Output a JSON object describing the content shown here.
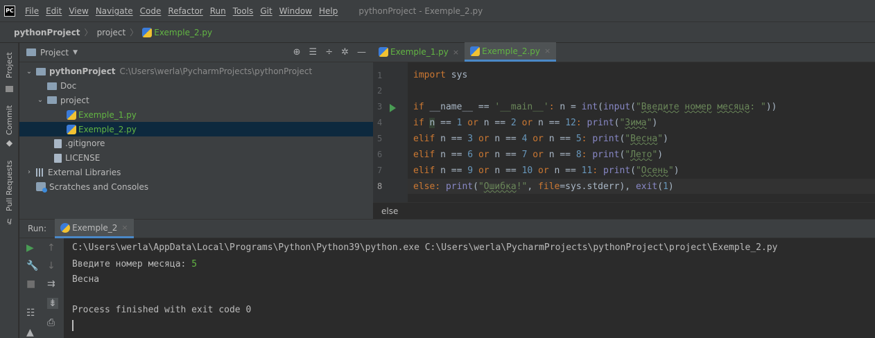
{
  "menubar": {
    "logo": "PC",
    "items": [
      "File",
      "Edit",
      "View",
      "Navigate",
      "Code",
      "Refactor",
      "Run",
      "Tools",
      "Git",
      "Window",
      "Help"
    ],
    "window_title": "pythonProject - Exemple_2.py"
  },
  "breadcrumb": {
    "project": "pythonProject",
    "folder": "project",
    "file": "Exemple_2.py"
  },
  "left_strip": {
    "project": "Project",
    "commit": "Commit",
    "pull_requests": "Pull Requests"
  },
  "project_panel": {
    "title": "Project",
    "tree": {
      "root": "pythonProject",
      "root_path": "C:\\Users\\werla\\PycharmProjects\\pythonProject",
      "doc": "Doc",
      "project": "project",
      "file1": "Exemple_1.py",
      "file2": "Exemple_2.py",
      "gitignore": ".gitignore",
      "license": "LICENSE",
      "external": "External Libraries",
      "scratches": "Scratches and Consoles"
    }
  },
  "editor": {
    "tabs": [
      "Exemple_1.py",
      "Exemple_2.py"
    ],
    "line_numbers": [
      "1",
      "2",
      "3",
      "4",
      "5",
      "6",
      "7",
      "8"
    ],
    "status": "else"
  },
  "run": {
    "label": "Run:",
    "tab": "Exemple_2",
    "command": "C:\\Users\\werla\\AppData\\Local\\Programs\\Python\\Python39\\python.exe C:\\Users\\werla\\PycharmProjects\\pythonProject\\project\\Exemple_2.py",
    "prompt": "Введите номер месяца: ",
    "input": "5",
    "output": "Весна",
    "finished": "Process finished with exit code 0"
  },
  "colors": {
    "background": "#2b2b2b",
    "panel": "#3c3f41",
    "keyword": "#cc7832",
    "string": "#6a8759",
    "number": "#6897bb",
    "builtin": "#8888c6",
    "selection": "#0d293e",
    "accent": "#4a88c7",
    "green": "#62b543"
  }
}
